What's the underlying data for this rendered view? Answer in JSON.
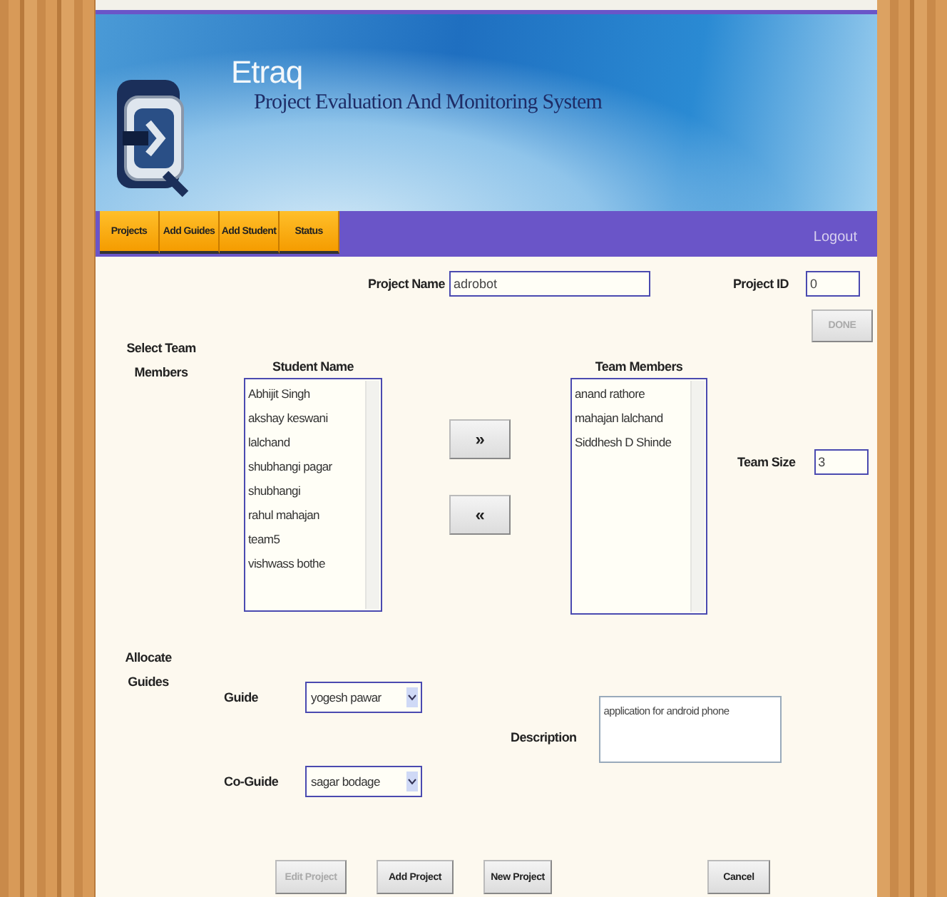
{
  "header": {
    "app_name": "Etraq",
    "subtitle": "Project Evaluation And Monitoring System"
  },
  "nav": {
    "tabs": [
      {
        "label": "Projects"
      },
      {
        "label": "Add Guides"
      },
      {
        "label": "Add Student"
      },
      {
        "label": "Status"
      }
    ],
    "logout": "Logout"
  },
  "project": {
    "name_label": "Project Name",
    "name_value": "adrobot",
    "id_label": "Project ID",
    "id_value": "0",
    "done_button": {
      "label": "DONE",
      "disabled": true
    }
  },
  "team": {
    "section_label": "Select Team Members",
    "students_heading": "Student Name",
    "students": [
      "Abhijit Singh",
      "akshay keswani",
      "lalchand",
      "shubhangi pagar",
      "shubhangi",
      "rahul mahajan",
      "team5",
      "vishwass bothe"
    ],
    "add_button": "»",
    "remove_button": "«",
    "members_heading": "Team Members",
    "members": [
      "anand rathore",
      "mahajan lalchand",
      "Siddhesh D Shinde"
    ],
    "size_label": "Team Size",
    "size_value": "3"
  },
  "guides": {
    "section_label": "Allocate Guides",
    "guide_label": "Guide",
    "guide_value": "yogesh pawar",
    "coguide_label": "Co-Guide",
    "coguide_value": "sagar bodage",
    "description_label": "Description",
    "description_value": "application for android phone"
  },
  "buttons": [
    {
      "label": "Edit Project",
      "disabled": true,
      "kind": "left"
    },
    {
      "label": "Add Project",
      "disabled": false,
      "kind": "left"
    },
    {
      "label": "New Project",
      "disabled": false,
      "kind": "left"
    },
    {
      "label": "Cancel",
      "disabled": false,
      "kind": "right"
    }
  ]
}
